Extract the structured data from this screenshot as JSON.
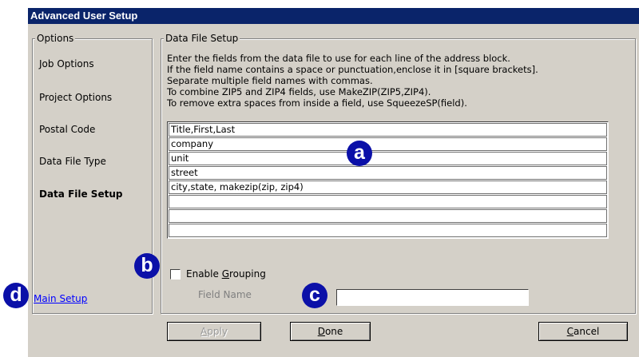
{
  "window": {
    "title": "Advanced User Setup"
  },
  "options": {
    "legend": "Options",
    "items": [
      {
        "label": "Job Options",
        "active": false
      },
      {
        "label": "Project Options",
        "active": false
      },
      {
        "label": "Postal Code",
        "active": false
      },
      {
        "label": "Data File Type",
        "active": false
      },
      {
        "label": "Data File Setup",
        "active": true
      }
    ],
    "main_setup_link": "Main Setup"
  },
  "data_file_setup": {
    "legend": "Data File Setup",
    "instructions": [
      "Enter the fields from the data file to use for each line of the address block.",
      "If the field name contains a space or punctuation,enclose it in [square brackets].",
      "Separate multiple field names with commas.",
      "To combine ZIP5 and ZIP4 fields, use MakeZIP(ZIP5,ZIP4).",
      "To remove extra spaces from inside a field, use SqueezeSP(field)."
    ],
    "address_lines": [
      "Title,First,Last",
      "company",
      "unit",
      "street",
      "city,state, makezip(zip, zip4)",
      "",
      "",
      ""
    ],
    "enable_grouping": {
      "label": "Enable Grouping",
      "checked": false
    },
    "field_name": {
      "label": "Field Name",
      "value": ""
    }
  },
  "buttons": {
    "apply": "Apply",
    "done": "Done",
    "cancel": "Cancel"
  },
  "callouts": {
    "a": "a",
    "b": "b",
    "c": "c",
    "d": "d"
  },
  "colors": {
    "titlebar": "#0a246a",
    "callout": "#0b10a8",
    "dialog": "#d4d0c8"
  }
}
